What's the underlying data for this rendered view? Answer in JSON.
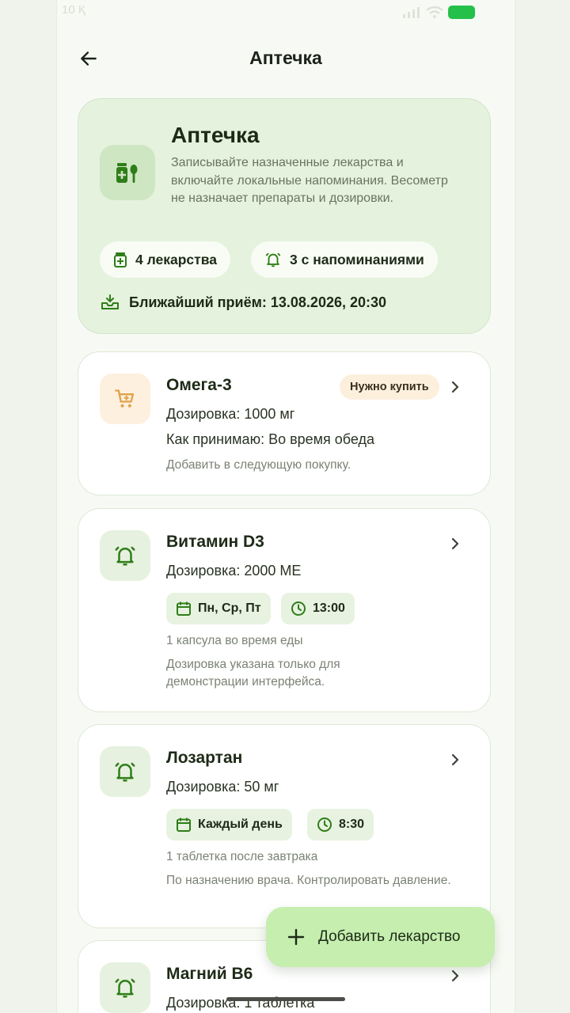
{
  "status_bar": {
    "left_text": "10 Қ"
  },
  "header": {
    "title": "Аптечка"
  },
  "summary": {
    "title": "Аптечка",
    "description": "Записывайте назначенные лекарства и включайте локальные напоминания. Весометр не назначает препараты и дозировки.",
    "count_label": "4 лекарства",
    "reminders_label": "3 с напоминаниями",
    "next_dose": "Ближайший приём: 13.08.2026, 20:30"
  },
  "medications": [
    {
      "name": "Омега-3",
      "badge": "Нужно купить",
      "dosage": "Дозировка: 1000 мг",
      "how": "Как принимаю: Во время обеда",
      "note": "Добавить в следующую покупку."
    },
    {
      "name": "Витамин D3",
      "dosage": "Дозировка: 2000 МЕ",
      "days": "Пн, Ср, Пт",
      "time": "13:00",
      "instruction": "1 капсула во время еды",
      "note": "Дозировка указана только для демонстрации интерфейса."
    },
    {
      "name": "Лозартан",
      "dosage": "Дозировка: 50 мг",
      "days": "Каждый день",
      "time": "8:30",
      "instruction": "1 таблетка после завтрака",
      "note": "По назначению врача. Контролировать давление."
    },
    {
      "name": "Магний B6",
      "dosage": "Дозировка: 1 таблетка"
    }
  ],
  "fab": {
    "label": "Добавить лекарство"
  },
  "colors": {
    "accent": "#3a8f1f",
    "fab": "#c5eeaf",
    "summary_bg": "#e5f2dd",
    "badge_bg": "#fcf0dd",
    "cart_icon": "#e0a24a"
  }
}
